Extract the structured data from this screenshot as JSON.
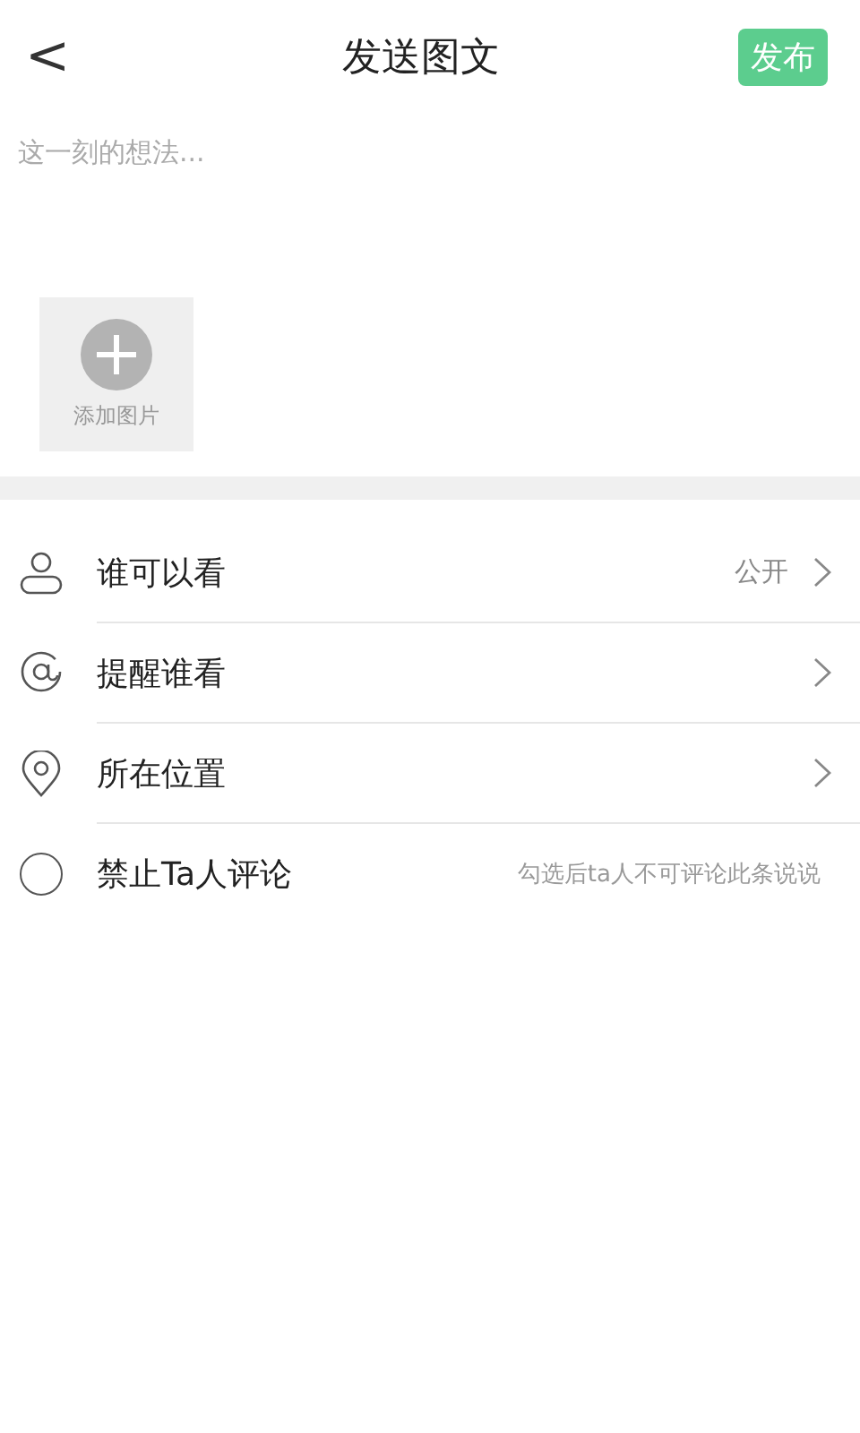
{
  "header": {
    "back": "<",
    "title": "发送图文",
    "publish": "发布"
  },
  "post": {
    "placeholder": "这一刻的想法...",
    "add_photo": "添加图片"
  },
  "options": [
    {
      "kind": "audience",
      "label": "谁可以看",
      "value": "公开"
    },
    {
      "kind": "mention",
      "label": "提醒谁看"
    },
    {
      "kind": "location",
      "label": "所在位置"
    },
    {
      "kind": "checkbox",
      "label": "禁止Ta人评论",
      "hint": "勾选后ta人不可评论此条说说",
      "checked": false
    }
  ]
}
